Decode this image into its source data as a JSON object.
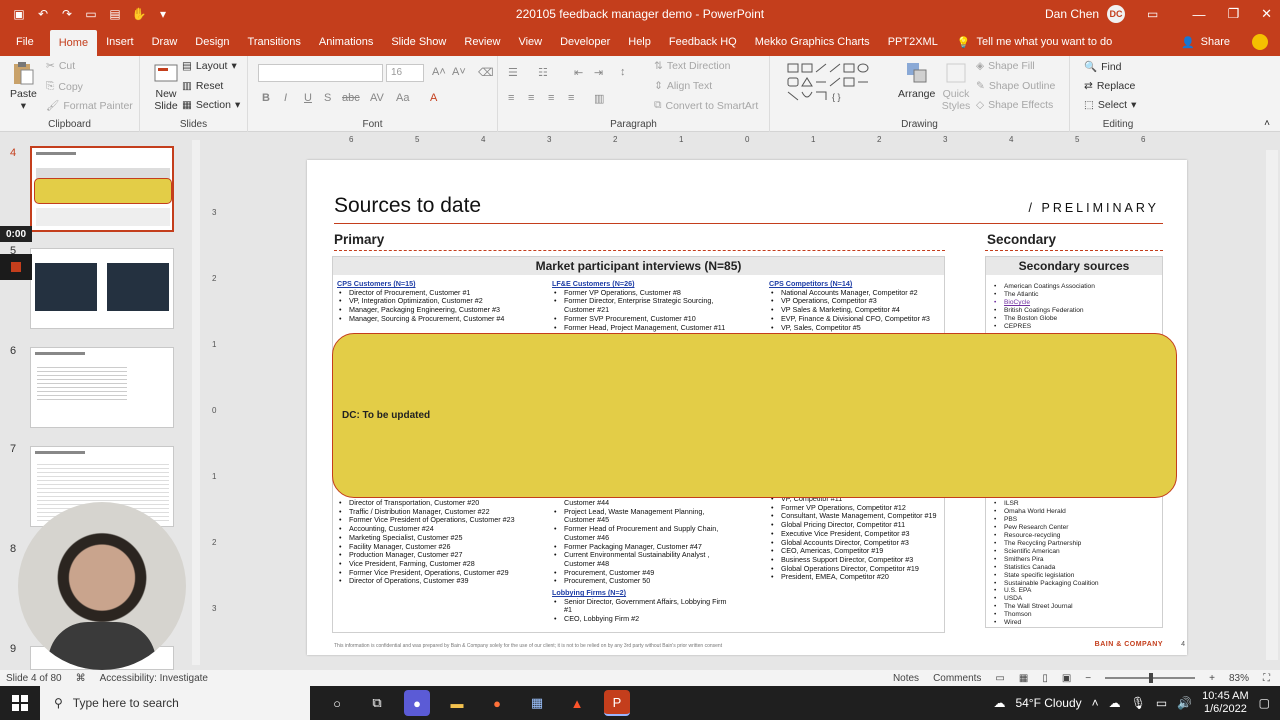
{
  "window": {
    "title": "220105 feedback manager demo  -  PowerPoint",
    "user_name": "Dan Chen",
    "user_initials": "DC"
  },
  "ribbon": {
    "tabs": [
      "File",
      "Home",
      "Insert",
      "Draw",
      "Design",
      "Transitions",
      "Animations",
      "Slide Show",
      "Review",
      "View",
      "Developer",
      "Help",
      "Feedback HQ",
      "Mekko Graphics Charts",
      "PPT2XML"
    ],
    "tell_me": "Tell me what you want to do",
    "share": "Share",
    "clipboard": {
      "label": "Clipboard",
      "paste": "Paste",
      "cut": "Cut",
      "copy": "Copy",
      "format_painter": "Format Painter"
    },
    "slides": {
      "label": "Slides",
      "new_slide": "New Slide",
      "layout": "Layout",
      "reset": "Reset",
      "section": "Section"
    },
    "font": {
      "label": "Font",
      "size": "16"
    },
    "paragraph": {
      "label": "Paragraph",
      "text_direction": "Text Direction",
      "align_text": "Align Text",
      "smartart": "Convert to SmartArt"
    },
    "drawing": {
      "label": "Drawing",
      "arrange": "Arrange",
      "quick_styles": "Quick Styles",
      "shape_fill": "Shape Fill",
      "shape_outline": "Shape Outline",
      "shape_effects": "Shape Effects"
    },
    "editing": {
      "label": "Editing",
      "find": "Find",
      "replace": "Replace",
      "select": "Select"
    }
  },
  "thumbnails": {
    "numbers": [
      "4",
      "5",
      "6",
      "7",
      "8",
      "9"
    ],
    "timer": "0:00"
  },
  "ruler": {
    "h_ticks": [
      "6",
      "5",
      "4",
      "3",
      "2",
      "1",
      "0",
      "1",
      "2",
      "3",
      "4",
      "5",
      "6"
    ],
    "v_ticks": [
      "3",
      "2",
      "1",
      "0",
      "1",
      "2",
      "3"
    ]
  },
  "slide": {
    "title": "Sources to date",
    "tag": "/ PRELIMINARY",
    "primary": "Primary",
    "secondary": "Secondary",
    "market_header": "Market participant interviews (N=85)",
    "secondary_header": "Secondary sources",
    "cps_customers": {
      "header": "CPS Customers (N=15)",
      "top": [
        "Director of Procurement, Customer #1",
        "VP, Integration Optimization, Customer #2",
        "Manager, Packaging Engineering, Customer #3",
        "Manager, Sourcing & Procurement, Customer #4"
      ],
      "bottom": [
        "Director of Transportation, Customer #20",
        "Traffic / Distribution Manager, Customer #22",
        "Former Vice President of Operations, Customer #23",
        "Accounting, Customer #24",
        "Marketing Specialist, Customer #25",
        "Facility Manager, Customer #26",
        "Production Manager, Customer #27",
        "Vice President, Farming, Customer #28",
        "Former Vice President, Operations, Customer #29",
        "Director of Operations, Customer #39"
      ]
    },
    "lfe_customers": {
      "header": "LF&E Customers (N=26)",
      "top": [
        "Former VP Operations, Customer #8",
        "Former Director, Enterprise Strategic Sourcing, Customer #21",
        "Former SVP Procurement, Customer #10",
        "Former Head, Project Management, Customer #11"
      ],
      "bottom_first": "Customer #44",
      "bottom": [
        "Project Lead, Waste Management Planning, Customer #45",
        "Former Head of Procurement and Supply Chain, Customer #46",
        "Former Packaging Manager, Customer #47",
        "Current Environmental Sustainability Analyst , Customer #48",
        "Procurement, Customer #49",
        "Procurement, Customer 50"
      ]
    },
    "lobbying": {
      "header": "Lobbying Firms (N=2)",
      "items": [
        "Senior Director, Government Affairs, Lobbying Firm #1",
        "CEO, Lobbying Firm #2"
      ]
    },
    "cps_competitors": {
      "header": "CPS Competitors (N=14)",
      "top": [
        "National Accounts Manager, Competitor #2",
        "VP Operations, Competitor #3",
        "VP Sales & Marketing, Competitor #4",
        "EVP, Finance & Divisional CFO, Competitor #3",
        "VP, Sales, Competitor #5"
      ],
      "bottom": [
        "VP, Competitor #11",
        "Former VP Operations, Competitor #12",
        "Consultant, Waste Management, Competitor #19",
        "Global Pricing Director, Competitor #11",
        "Executive Vice President, Competitor #3",
        "Global Accounts Director, Competitor #3",
        "CEO, Americas, Competitor #19",
        "Business Support Director, Competitor #3",
        "Global Operations Director, Competitor #19",
        "President, EMEA, Competitor #20"
      ]
    },
    "secondary_top": [
      "American Coatings Association",
      "The Atlantic",
      "BioCycle",
      "British Coatings Federation",
      "The Boston Globe",
      "CEPRES"
    ],
    "secondary_bottom": [
      "ILSR",
      "Omaha World Herald",
      "PBS",
      "Pew Research Center",
      "Resource-recycling",
      "The Recycling Partnership",
      "Scientific American",
      "Smithers Pira",
      "Statistics Canada",
      "State specific legislation",
      "Sustainable Packaging Coalition",
      "U.S. EPA",
      "USDA",
      "The Wall Street Journal",
      "Thomson",
      "Wired"
    ],
    "sticky_note": "DC: To be updated",
    "footer": "This information is confidential and was prepared by Bain & Company solely for the use of our client; it is not to be relied on by any 3rd party without Bain's prior written consent",
    "brand": "BAIN & COMPANY",
    "page": "4"
  },
  "statusbar": {
    "slide_info": "Slide 4 of 80",
    "accessibility": "Accessibility: Investigate",
    "notes": "Notes",
    "comments": "Comments",
    "zoom": "83%"
  },
  "taskbar": {
    "search_placeholder": "Type here to search",
    "weather": "54°F  Cloudy",
    "time": "10:45 AM",
    "date": "1/6/2022"
  },
  "colors": {
    "accent": "#c43e1c",
    "sticky": "#e3cd47",
    "link": "#1f3ea6"
  }
}
